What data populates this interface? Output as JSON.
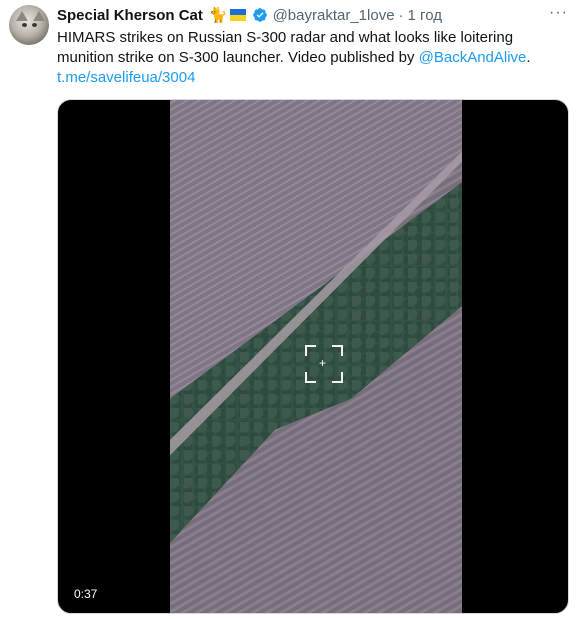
{
  "tweet": {
    "author_name": "Special Kherson Cat",
    "author_emoji": "🐈",
    "handle": "@bayraktar_1love",
    "separator": "·",
    "time": "1 год",
    "more": "···",
    "text_main": "HIMARS strikes on Russian S-300 radar and what looks like loitering munition strike on S-300 launcher. Video published by ",
    "mention": "@BackAndAlive",
    "text_end": ".",
    "link": "t.me/savelifeua/3004"
  },
  "media": {
    "duration": "0:37"
  },
  "colors": {
    "link": "#1d9bf0",
    "verified": "#1d9bf0",
    "muted": "#536471",
    "flag_blue": "#1d6fd8",
    "flag_yellow": "#f7d21e"
  },
  "icons": {
    "verified": "verified-badge-icon",
    "flag": "ukraine-flag-icon",
    "more": "more-icon"
  }
}
